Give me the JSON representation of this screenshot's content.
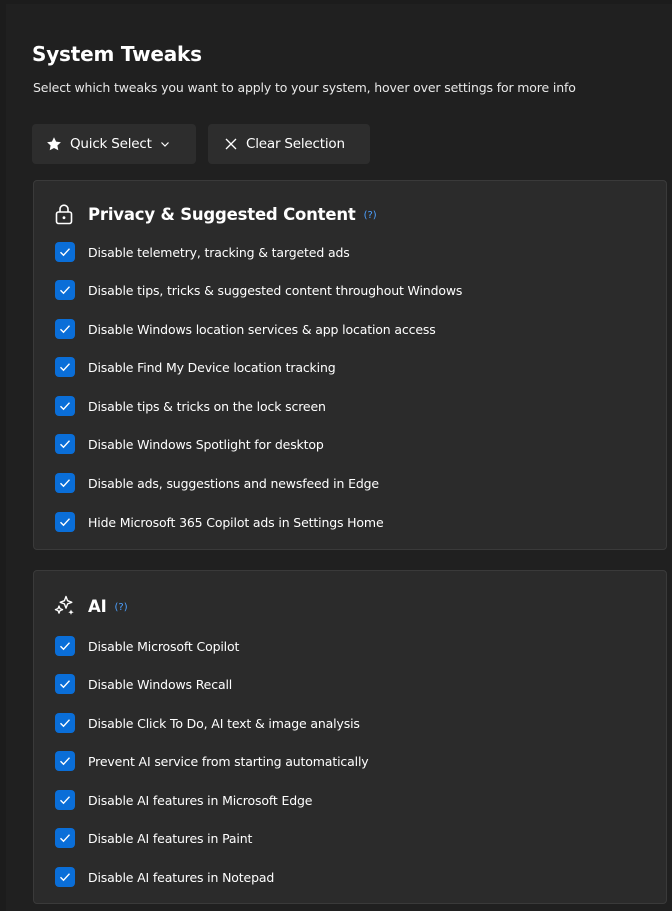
{
  "header": {
    "title": "System Tweaks",
    "subtitle": "Select which tweaks you want to apply to your system, hover over settings for more info"
  },
  "toolbar": {
    "quick_select_label": "Quick Select",
    "clear_selection_label": "Clear Selection"
  },
  "groups": [
    {
      "title": "Privacy & Suggested Content",
      "help": "(?)",
      "icon": "lock-icon",
      "options": [
        {
          "label": "Disable telemetry, tracking & targeted ads",
          "checked": true
        },
        {
          "label": "Disable tips, tricks & suggested content throughout Windows",
          "checked": true
        },
        {
          "label": "Disable Windows location services & app location access",
          "checked": true
        },
        {
          "label": "Disable Find My Device location tracking",
          "checked": true
        },
        {
          "label": "Disable tips & tricks on the lock screen",
          "checked": true
        },
        {
          "label": "Disable Windows Spotlight for desktop",
          "checked": true
        },
        {
          "label": "Disable ads, suggestions and newsfeed in Edge",
          "checked": true
        },
        {
          "label": "Hide Microsoft 365 Copilot ads in Settings Home",
          "checked": true
        }
      ]
    },
    {
      "title": "AI",
      "help": "(?)",
      "icon": "ai-sparkle-icon",
      "options": [
        {
          "label": "Disable Microsoft Copilot",
          "checked": true
        },
        {
          "label": "Disable Windows Recall",
          "checked": true
        },
        {
          "label": "Disable Click To Do, AI text & image analysis",
          "checked": true
        },
        {
          "label": "Prevent AI service from starting automatically",
          "checked": true
        },
        {
          "label": "Disable AI features in Microsoft Edge",
          "checked": true
        },
        {
          "label": "Disable AI features in Paint",
          "checked": true
        },
        {
          "label": "Disable AI features in Notepad",
          "checked": true
        }
      ]
    }
  ],
  "colors": {
    "background": "#202020",
    "card": "#2b2b2b",
    "accent": "#0a6ed8",
    "help": "#4ca0ff"
  }
}
